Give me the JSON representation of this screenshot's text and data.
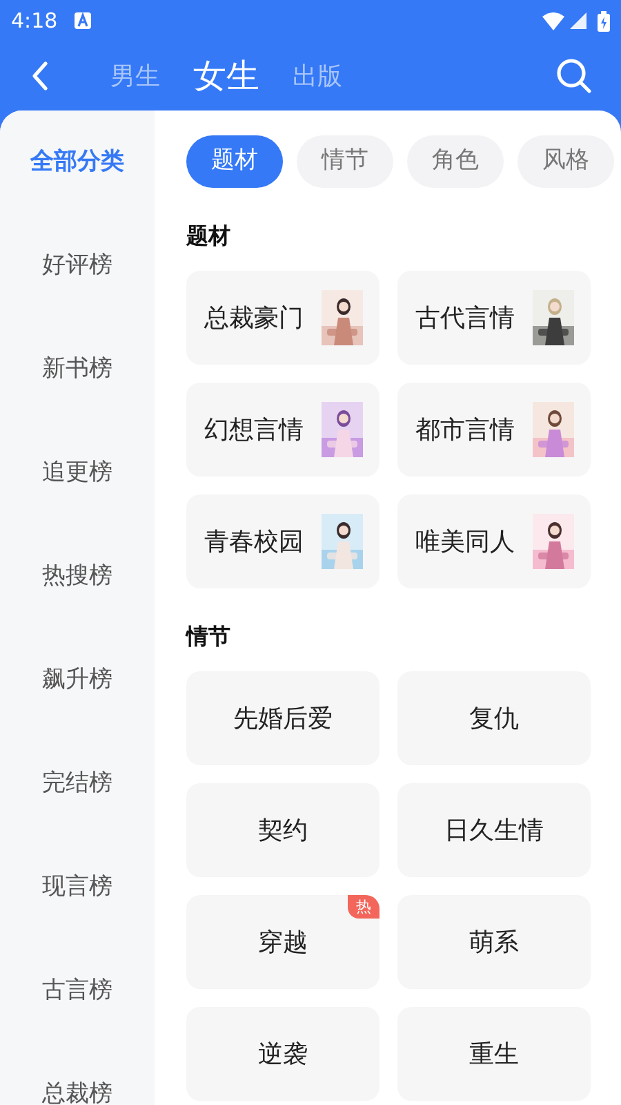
{
  "status_bar": {
    "time": "4:18"
  },
  "header": {
    "tabs": [
      {
        "label": "男生",
        "selected": false
      },
      {
        "label": "女生",
        "selected": true
      },
      {
        "label": "出版",
        "selected": false
      }
    ]
  },
  "sidebar": {
    "items": [
      {
        "label": "全部分类",
        "selected": true
      },
      {
        "label": "好评榜",
        "selected": false
      },
      {
        "label": "新书榜",
        "selected": false
      },
      {
        "label": "追更榜",
        "selected": false
      },
      {
        "label": "热搜榜",
        "selected": false
      },
      {
        "label": "飙升榜",
        "selected": false
      },
      {
        "label": "完结榜",
        "selected": false
      },
      {
        "label": "现言榜",
        "selected": false
      },
      {
        "label": "古言榜",
        "selected": false
      },
      {
        "label": "总裁榜",
        "selected": false
      }
    ]
  },
  "filter_chips": [
    {
      "label": "题材",
      "selected": true
    },
    {
      "label": "情节",
      "selected": false
    },
    {
      "label": "角色",
      "selected": false
    },
    {
      "label": "风格",
      "selected": false
    }
  ],
  "sections": [
    {
      "title": "题材",
      "items": [
        {
          "label": "总裁豪门",
          "kind": "cover"
        },
        {
          "label": "古代言情",
          "kind": "cover"
        },
        {
          "label": "幻想言情",
          "kind": "cover"
        },
        {
          "label": "都市言情",
          "kind": "cover"
        },
        {
          "label": "青春校园",
          "kind": "cover"
        },
        {
          "label": "唯美同人",
          "kind": "cover"
        }
      ]
    },
    {
      "title": "情节",
      "items": [
        {
          "label": "先婚后爱",
          "kind": "plain"
        },
        {
          "label": "复仇",
          "kind": "plain"
        },
        {
          "label": "契约",
          "kind": "plain"
        },
        {
          "label": "日久生情",
          "kind": "plain"
        },
        {
          "label": "穿越",
          "kind": "plain",
          "badge": "热"
        },
        {
          "label": "萌系",
          "kind": "plain"
        },
        {
          "label": "逆袭",
          "kind": "plain"
        },
        {
          "label": "重生",
          "kind": "plain"
        }
      ]
    }
  ]
}
